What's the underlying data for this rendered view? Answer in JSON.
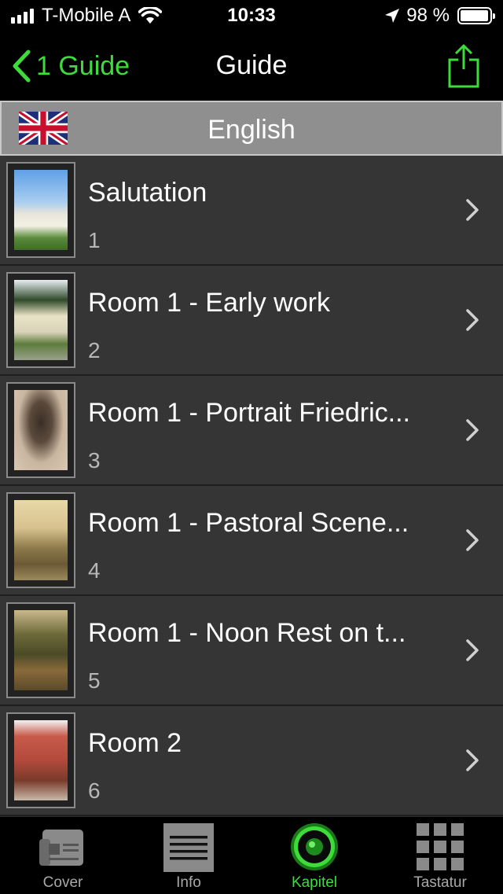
{
  "status_bar": {
    "carrier": "T-Mobile A",
    "time": "10:33",
    "battery": "98 %",
    "battery_level": 0.98
  },
  "nav": {
    "back_label": "1 Guide",
    "title": "Guide"
  },
  "language": {
    "label": "English",
    "flag": "uk-flag-icon"
  },
  "items": [
    {
      "title": "Salutation",
      "number": "1"
    },
    {
      "title": "Room 1 - Early work",
      "number": "2"
    },
    {
      "title": "Room 1 - Portrait Friedric...",
      "number": "3"
    },
    {
      "title": "Room 1 - Pastoral Scene...",
      "number": "4"
    },
    {
      "title": "Room 1 - Noon Rest on t...",
      "number": "5"
    },
    {
      "title": "Room 2",
      "number": "6"
    }
  ],
  "tabs": [
    {
      "label": "Cover",
      "icon": "newspaper-icon",
      "active": false
    },
    {
      "label": "Info",
      "icon": "document-icon",
      "active": false
    },
    {
      "label": "Kapitel",
      "icon": "speaker-icon",
      "active": true
    },
    {
      "label": "Tastatur",
      "icon": "keypad-icon",
      "active": false
    }
  ],
  "colors": {
    "accent": "#3ddc3a",
    "row_bg": "#353535",
    "header_bg": "#8f8f8f"
  }
}
